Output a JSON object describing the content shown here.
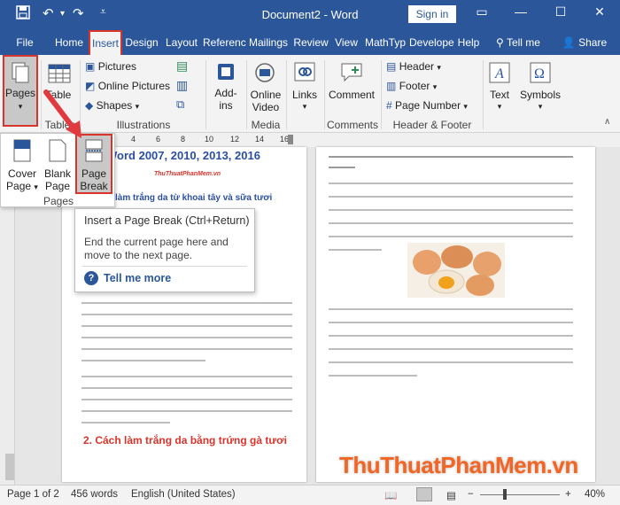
{
  "titlebar": {
    "title": "Document2  -  Word",
    "signin": "Sign in",
    "minimize": "—",
    "maximize": "☐",
    "close": "✕",
    "restore": "▭"
  },
  "tabs": [
    {
      "label": "File"
    },
    {
      "label": "Home"
    },
    {
      "label": "Insert"
    },
    {
      "label": "Design"
    },
    {
      "label": "Layout"
    },
    {
      "label": "Referenc"
    },
    {
      "label": "Mailings"
    },
    {
      "label": "Review"
    },
    {
      "label": "View"
    },
    {
      "label": "MathTyp"
    },
    {
      "label": "Develope"
    },
    {
      "label": "Help"
    }
  ],
  "tellme": "Tell me",
  "share": "Share",
  "ribbon": {
    "pages": "Pages",
    "table": "Table",
    "pictures": "Pictures",
    "online_pictures": "Online Pictures",
    "shapes": "Shapes",
    "addins_1": "Add-",
    "addins_2": "ins",
    "online_video_1": "Online",
    "online_video_2": "Video",
    "links": "Links",
    "comment": "Comment",
    "header": "Header",
    "footer": "Footer",
    "page_number": "Page Number",
    "text": "Text",
    "symbols": "Symbols",
    "groups": {
      "tables": "Tables",
      "illustrations": "Illustrations",
      "media": "Media",
      "comments": "Comments",
      "header_footer": "Header & Footer"
    }
  },
  "dropdown": {
    "cover_1": "Cover",
    "cover_2": "Page",
    "blank_1": "Blank",
    "blank_2": "Page",
    "break_1": "Page",
    "break_2": "Break",
    "group": "Pages"
  },
  "tooltip": {
    "title": "Insert a Page Break (Ctrl+Return)",
    "body_1": "End the current page here and",
    "body_2": "move to the next page.",
    "tell_more": "Tell me more"
  },
  "ruler_ticks": [
    "4",
    "6",
    "8",
    "10",
    "12",
    "14",
    "16"
  ],
  "document": {
    "heading_partial": "Word 2007, 2010, 2013, 2016",
    "watermark_small": "ThuThuatPhanMem.vn",
    "section1_partial": "làm trắng da từ khoai tây và sữa tươi",
    "section2": "2. Cách làm trắng da bằng trứng gà tươi"
  },
  "status": {
    "page": "Page 1 of 2",
    "words": "456 words",
    "language": "English (United States)",
    "zoom": "40%"
  },
  "watermark": "ThuThuatPhanMem.vn"
}
